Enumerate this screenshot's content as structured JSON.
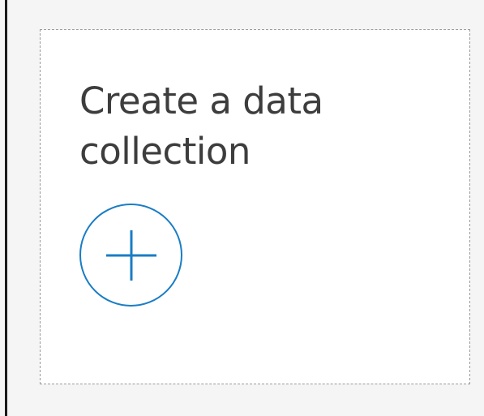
{
  "card": {
    "title": "Create a data collection"
  },
  "add_button": {
    "icon": "plus-icon",
    "label": "Create a data collection"
  },
  "colors": {
    "background": "#f5f5f5",
    "card_background": "#ffffff",
    "card_border": "#9a9a9a",
    "title_text": "#3d3d3d",
    "accent": "#1a7dc4",
    "divider": "#1a1a1a"
  }
}
